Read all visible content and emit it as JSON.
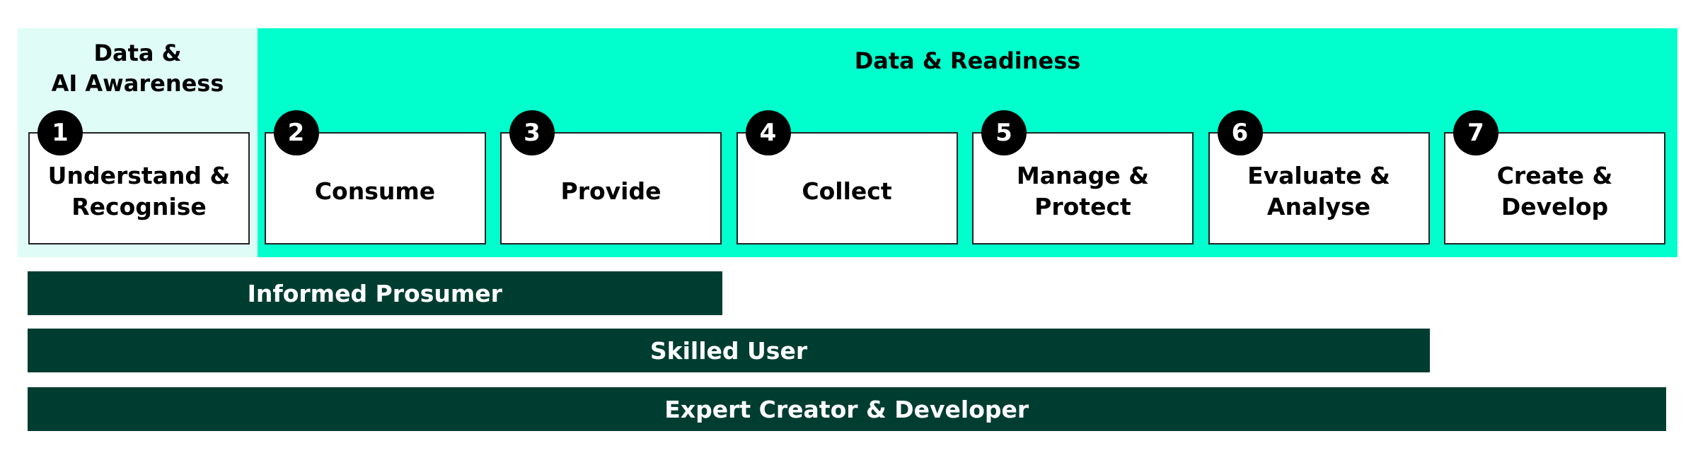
{
  "colors": {
    "awareness_bg": "#dffcf6",
    "readiness_bg": "#00ffcc",
    "bar_bg": "#003d31",
    "box_border": "#222222"
  },
  "awareness": {
    "title_line1": "Data &",
    "title_line2": "AI Awareness"
  },
  "readiness": {
    "title": "Data & Readiness"
  },
  "steps": [
    {
      "num": "1",
      "line1": "Understand &",
      "line2": "Recognise"
    },
    {
      "num": "2",
      "line1": "Consume",
      "line2": ""
    },
    {
      "num": "3",
      "line1": "Provide",
      "line2": ""
    },
    {
      "num": "4",
      "line1": "Collect",
      "line2": ""
    },
    {
      "num": "5",
      "line1": "Manage &",
      "line2": "Protect"
    },
    {
      "num": "6",
      "line1": "Evaluate &",
      "line2": "Analyse"
    },
    {
      "num": "7",
      "line1": "Create &",
      "line2": "Develop"
    }
  ],
  "levels": [
    {
      "label": "Informed Prosumer",
      "spans_steps": 3
    },
    {
      "label": "Skilled User",
      "spans_steps": 6
    },
    {
      "label": "Expert Creator & Developer",
      "spans_steps": 7
    }
  ]
}
